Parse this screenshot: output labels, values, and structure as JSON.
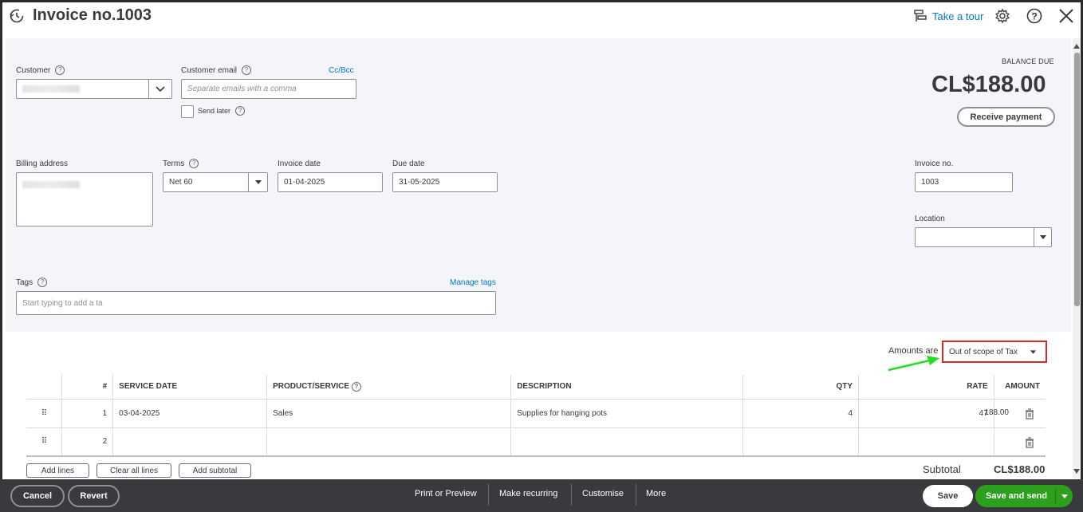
{
  "header": {
    "title": "Invoice no.1003",
    "tour_label": "Take a tour"
  },
  "customer": {
    "label": "Customer",
    "value": ""
  },
  "customer_email": {
    "label": "Customer email",
    "placeholder": "Separate emails with a comma",
    "cc_bcc": "Cc/Bcc",
    "send_later": "Send later"
  },
  "balance": {
    "label": "BALANCE DUE",
    "amount": "CL$188.00",
    "receive_payment": "Receive payment"
  },
  "billing": {
    "label": "Billing address"
  },
  "terms": {
    "label": "Terms",
    "value": "Net 60"
  },
  "invoice_date": {
    "label": "Invoice date",
    "value": "01-04-2025"
  },
  "due_date": {
    "label": "Due date",
    "value": "31-05-2025"
  },
  "invoice_no": {
    "label": "Invoice no.",
    "value": "1003"
  },
  "location": {
    "label": "Location",
    "value": ""
  },
  "tags": {
    "label": "Tags",
    "manage": "Manage tags",
    "placeholder": "Start typing to add a ta"
  },
  "amounts": {
    "label": "Amounts are",
    "value": "Out of scope of Tax"
  },
  "table": {
    "headers": {
      "num": "#",
      "service_date": "SERVICE DATE",
      "product": "PRODUCT/SERVICE",
      "description": "DESCRIPTION",
      "qty": "QTY",
      "rate": "RATE",
      "amount": "AMOUNT"
    },
    "rows": [
      {
        "num": "1",
        "service_date": "03-04-2025",
        "product": "Sales",
        "description": "Supplies for hanging pots",
        "qty": "4",
        "rate": "47",
        "amount": "188.00"
      },
      {
        "num": "2",
        "service_date": "",
        "product": "",
        "description": "",
        "qty": "",
        "rate": "",
        "amount": ""
      }
    ]
  },
  "line_buttons": {
    "add_lines": "Add lines",
    "clear_all": "Clear all lines",
    "add_subtotal": "Add subtotal"
  },
  "subtotal": {
    "label": "Subtotal",
    "value": "CL$188.00"
  },
  "footer": {
    "cancel": "Cancel",
    "revert": "Revert",
    "print_preview": "Print or Preview",
    "make_recurring": "Make recurring",
    "customise": "Customise",
    "more": "More",
    "save": "Save",
    "save_and_send": "Save and send"
  },
  "colors": {
    "link": "#0077c5",
    "primary_green": "#2ca01c",
    "highlight_red": "#d52b1e",
    "footer_bg": "#393a3d"
  }
}
